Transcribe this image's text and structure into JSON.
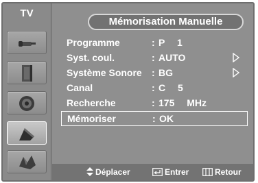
{
  "header": {
    "mode": "TV",
    "title": "Mémorisation Manuelle"
  },
  "sidebar": {
    "items": [
      {
        "icon": "antenna-icon",
        "active": false
      },
      {
        "icon": "picture-icon",
        "active": false
      },
      {
        "icon": "speaker-icon",
        "active": false
      },
      {
        "icon": "channel-icon",
        "active": true
      },
      {
        "icon": "setup-icon",
        "active": false
      }
    ]
  },
  "menu": {
    "rows": [
      {
        "label": "Programme",
        "value": "P 1",
        "has_arrow": false,
        "selected": false
      },
      {
        "label": "Syst. coul.",
        "value": "AUTO",
        "has_arrow": true,
        "selected": false
      },
      {
        "label": "Système Sonore",
        "value": "BG",
        "has_arrow": true,
        "selected": false
      },
      {
        "label": "Canal",
        "value": "C 5",
        "has_arrow": false,
        "selected": false
      },
      {
        "label": "Recherche",
        "value": "175 MHz",
        "has_arrow": false,
        "selected": false
      },
      {
        "label": "Mémoriser",
        "value": "OK",
        "has_arrow": false,
        "selected": true
      }
    ]
  },
  "footer": {
    "move_label": "Déplacer",
    "enter_label": "Entrer",
    "return_label": "Retour"
  },
  "colors": {
    "background": "#8f8f8f",
    "panel": "#727272",
    "text": "#ffffff"
  }
}
